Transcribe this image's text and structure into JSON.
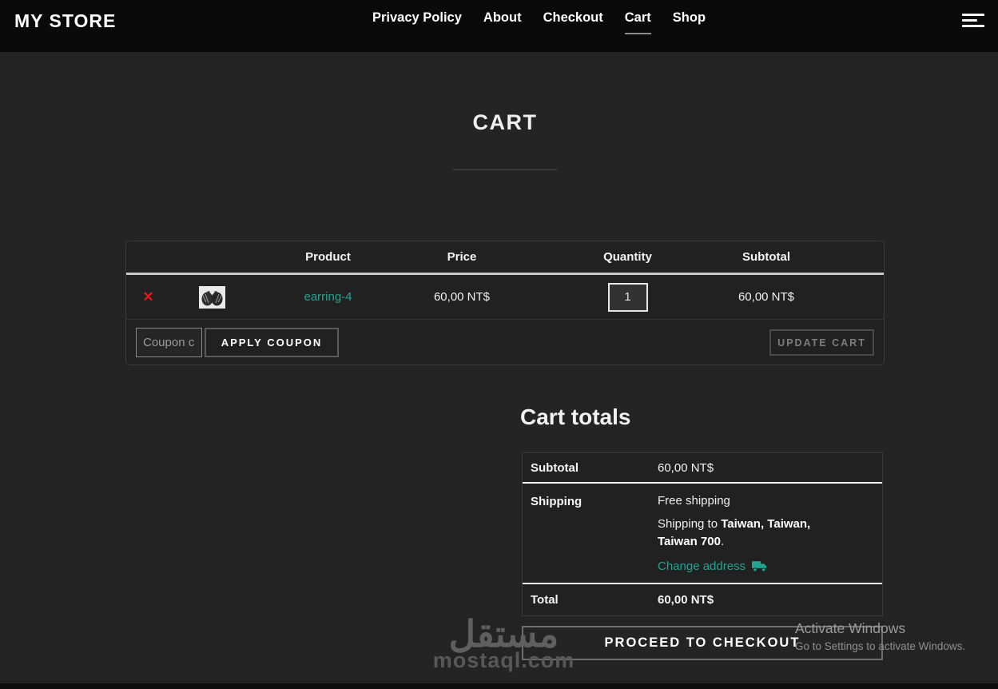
{
  "header": {
    "logo": "MY STORE",
    "nav": [
      {
        "label": "Privacy Policy"
      },
      {
        "label": "About"
      },
      {
        "label": "Checkout"
      },
      {
        "label": "Cart"
      },
      {
        "label": "Shop"
      }
    ]
  },
  "page": {
    "title": "CART"
  },
  "cart_table": {
    "columns": {
      "product": "Product",
      "price": "Price",
      "quantity": "Quantity",
      "subtotal": "Subtotal"
    },
    "item": {
      "name": "earring-4",
      "price": "60,00 NT$",
      "quantity": "1",
      "subtotal": "60,00 NT$"
    },
    "coupon_placeholder": "Coupon code",
    "apply_coupon_label": "APPLY COUPON",
    "update_cart_label": "UPDATE CART"
  },
  "cart_totals": {
    "title": "Cart totals",
    "subtotal_label": "Subtotal",
    "subtotal_value": "60,00 NT$",
    "shipping_label": "Shipping",
    "shipping_method": "Free shipping",
    "shipping_to_prefix": "Shipping to ",
    "shipping_destination": "Taiwan, Taiwan, Taiwan 700",
    "shipping_to_suffix": ".",
    "change_address_label": "Change address",
    "total_label": "Total",
    "total_value": "60,00 NT$",
    "checkout_label": "PROCEED TO CHECKOUT"
  },
  "icons": {
    "remove": "✕"
  },
  "watermark": {
    "logo_text": "مستقل",
    "domain": "mostaql.com"
  },
  "os_overlay": {
    "line1": "Activate Windows",
    "line2": "Go to Settings to activate Windows."
  },
  "colors": {
    "accent_teal": "#20a593",
    "remove_red": "#e01b1b",
    "header_bg": "#0a0a0a",
    "body_bg": "#242424"
  }
}
